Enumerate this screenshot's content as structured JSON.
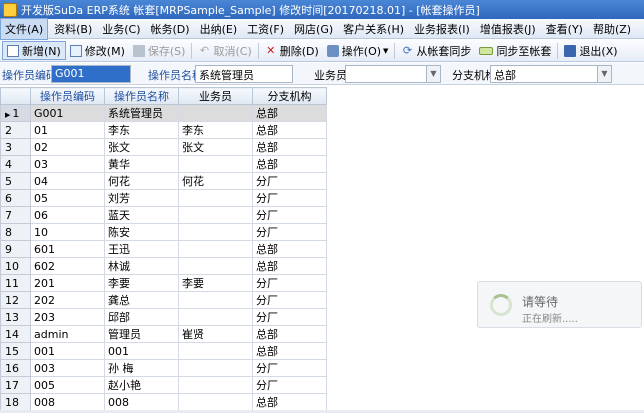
{
  "window": {
    "title": "开发版SuDa ERP系统  帐套[MRPSample_Sample] 修改时间[20170218.01] - [帐套操作员]"
  },
  "menu": [
    "文件(A)",
    "资料(B)",
    "业务(C)",
    "帐务(D)",
    "出纳(E)",
    "工资(F)",
    "网店(G)",
    "客户关系(H)",
    "业务报表(I)",
    "增值报表(J)",
    "查看(Y)",
    "帮助(Z)"
  ],
  "toolbar": {
    "new": "新增(N)",
    "edit": "修改(M)",
    "save": "保存(S)",
    "cancel": "取消(C)",
    "delete": "删除(D)",
    "operate": "操作(O)",
    "sync_from": "从帐套同步",
    "sync_to": "同步至帐套",
    "exit": "退出(X)"
  },
  "filter": {
    "code_label": "操作员编码",
    "code_value": "G001",
    "name_label": "操作员名称",
    "name_value": "系统管理员",
    "clerk_label": "业务员",
    "clerk_value": "",
    "branch_label": "分支机构",
    "branch_value": "总部"
  },
  "grid": {
    "columns": [
      "操作员编码",
      "操作员名称",
      "业务员",
      "分支机构"
    ],
    "rows": [
      {
        "n": "1",
        "code": "G001",
        "name": "系统管理员",
        "clerk": "",
        "branch": "总部"
      },
      {
        "n": "2",
        "code": "01",
        "name": "李东",
        "clerk": "李东",
        "branch": "总部"
      },
      {
        "n": "3",
        "code": "02",
        "name": "张文",
        "clerk": "张文",
        "branch": "总部"
      },
      {
        "n": "4",
        "code": "03",
        "name": "黄华",
        "clerk": "",
        "branch": "总部"
      },
      {
        "n": "5",
        "code": "04",
        "name": "何花",
        "clerk": "何花",
        "branch": "分厂"
      },
      {
        "n": "6",
        "code": "05",
        "name": "刘芳",
        "clerk": "",
        "branch": "分厂"
      },
      {
        "n": "7",
        "code": "06",
        "name": "蓝天",
        "clerk": "",
        "branch": "分厂"
      },
      {
        "n": "8",
        "code": "10",
        "name": "陈安",
        "clerk": "",
        "branch": "分厂"
      },
      {
        "n": "9",
        "code": "601",
        "name": "王迅",
        "clerk": "",
        "branch": "总部"
      },
      {
        "n": "10",
        "code": "602",
        "name": "林诚",
        "clerk": "",
        "branch": "总部"
      },
      {
        "n": "11",
        "code": "201",
        "name": "李要",
        "clerk": "李要",
        "branch": "分厂"
      },
      {
        "n": "12",
        "code": "202",
        "name": "龚总",
        "clerk": "",
        "branch": "分厂"
      },
      {
        "n": "13",
        "code": "203",
        "name": "邱部",
        "clerk": "",
        "branch": "分厂"
      },
      {
        "n": "14",
        "code": "admin",
        "name": "管理员",
        "clerk": "崔贤",
        "branch": "总部"
      },
      {
        "n": "15",
        "code": "001",
        "name": "001",
        "clerk": "",
        "branch": "总部"
      },
      {
        "n": "16",
        "code": "003",
        "name": "孙  梅",
        "clerk": "",
        "branch": "分厂"
      },
      {
        "n": "17",
        "code": "005",
        "name": "赵小艳",
        "clerk": "",
        "branch": "分厂"
      },
      {
        "n": "18",
        "code": "008",
        "name": "008",
        "clerk": "",
        "branch": "总部"
      }
    ]
  },
  "busy": {
    "title": "请等待",
    "subtitle": "正在刷新....."
  }
}
